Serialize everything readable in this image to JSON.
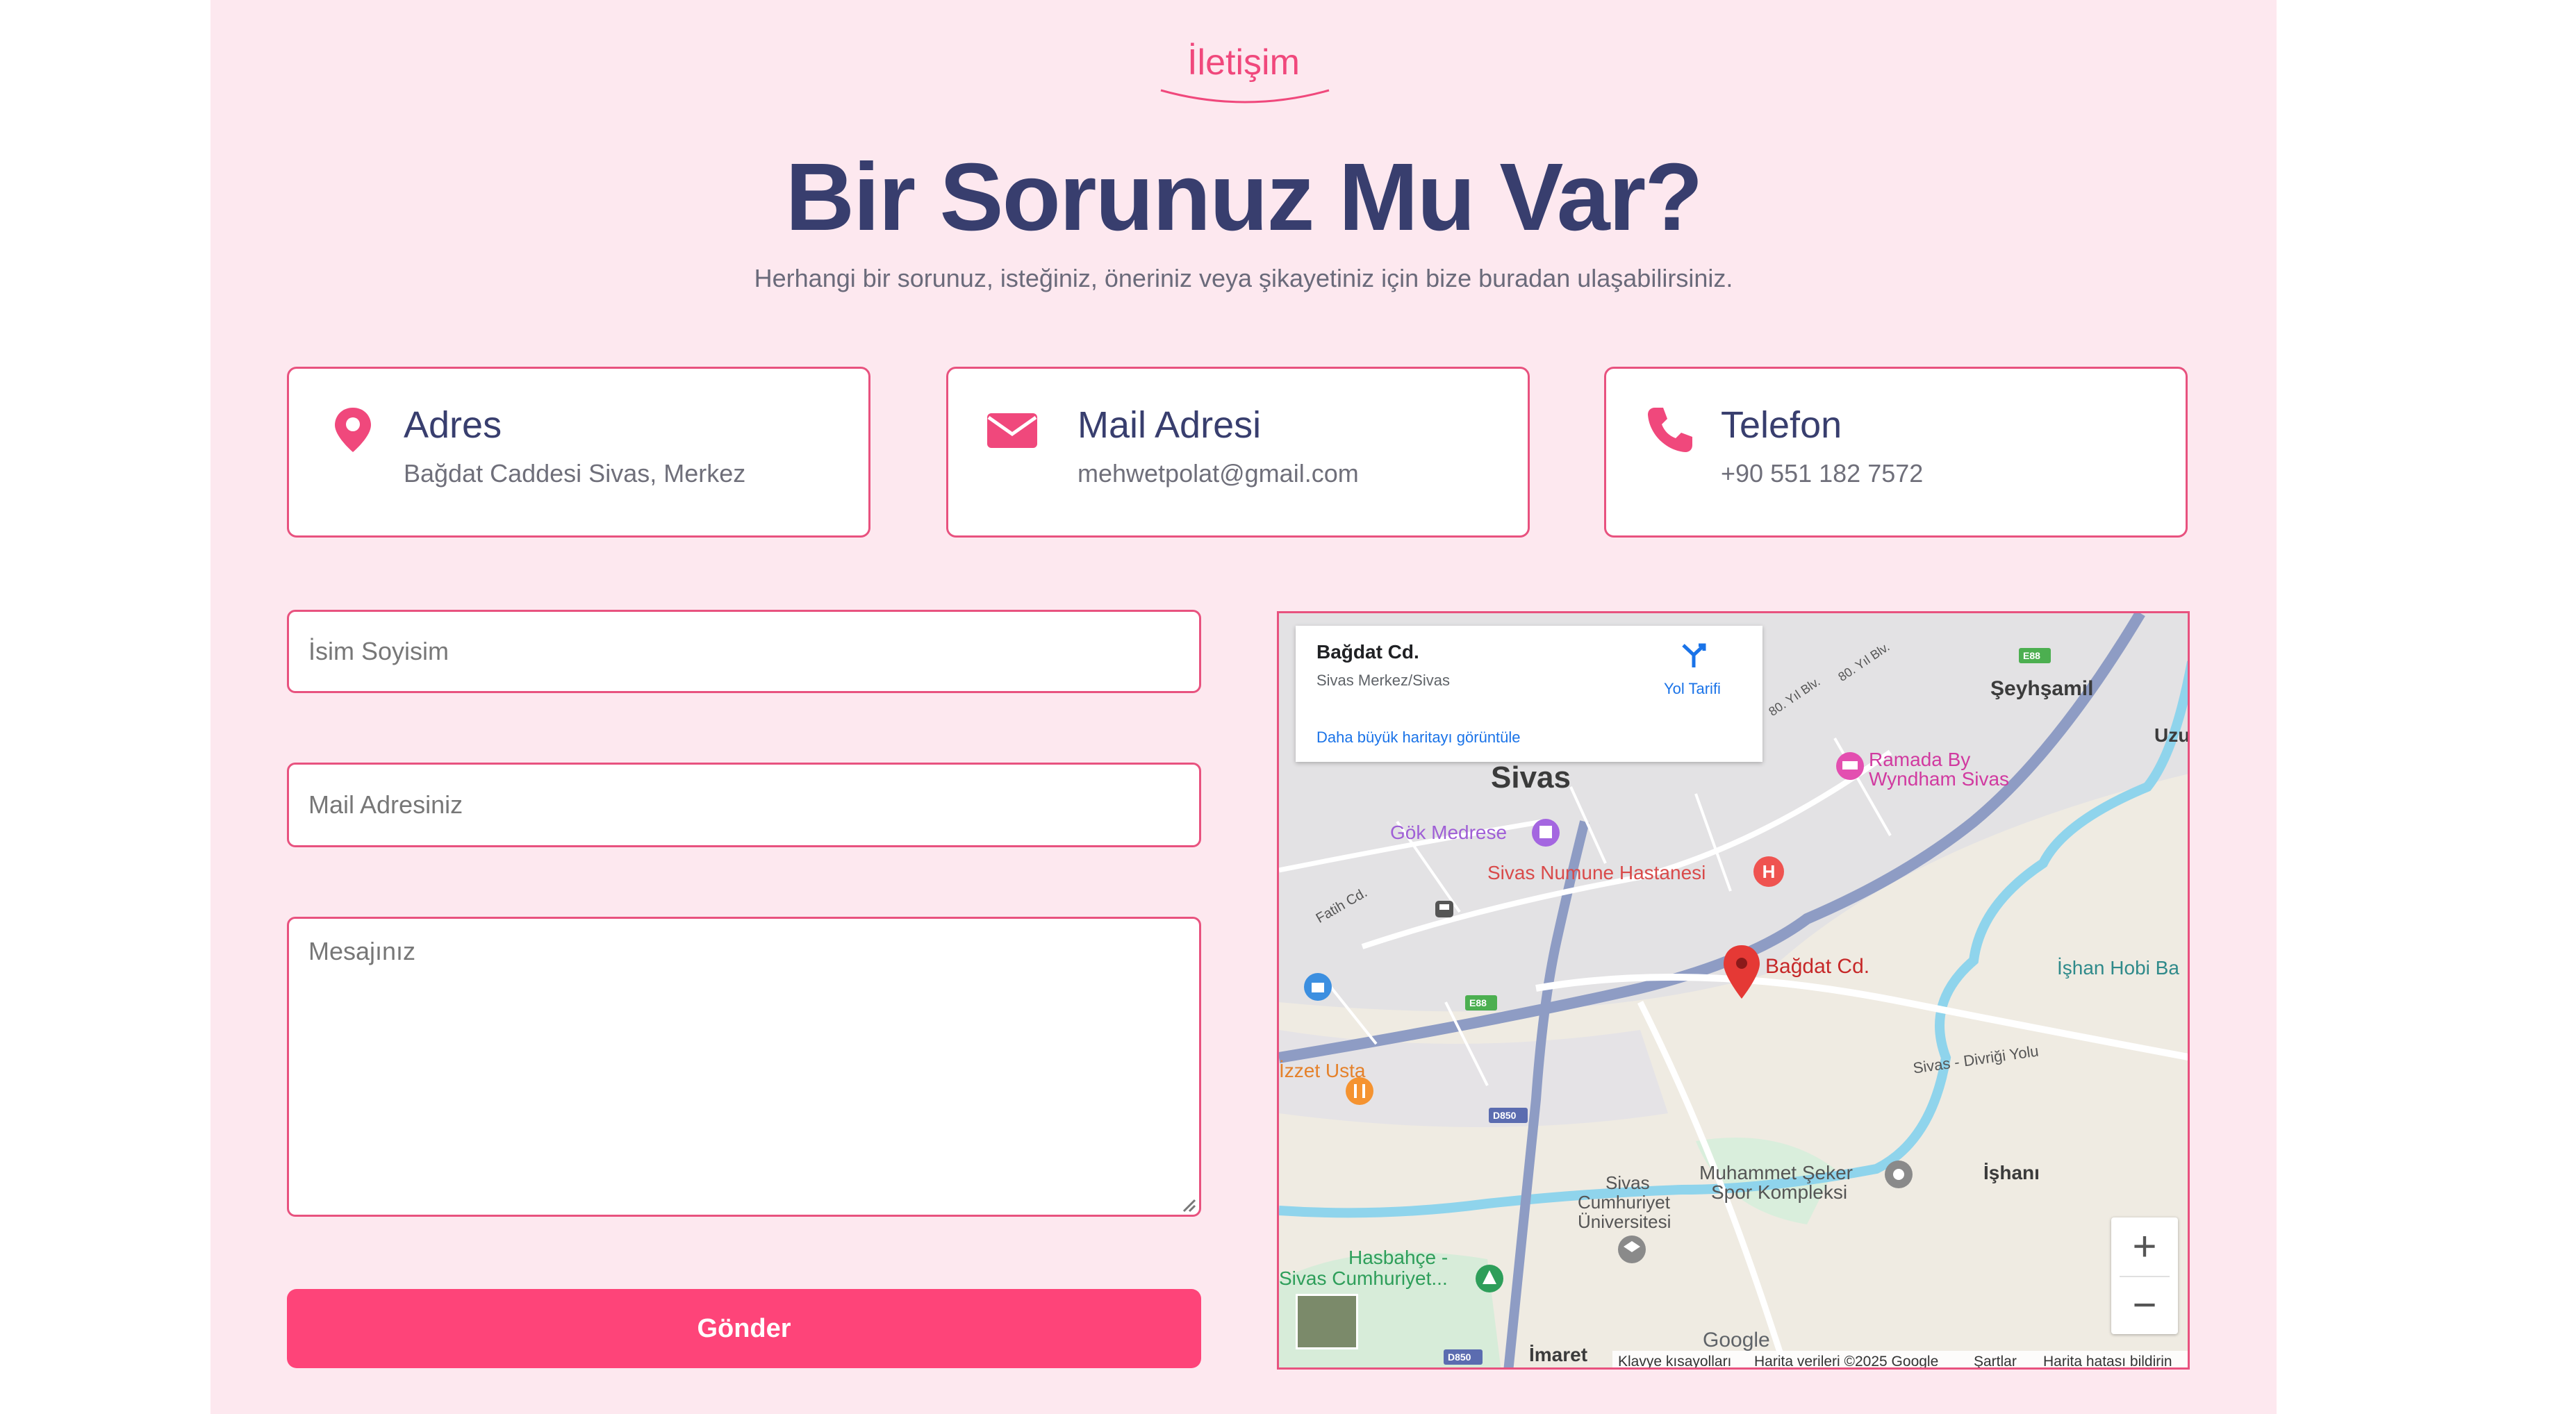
{
  "header": {
    "section_label": "İletişim",
    "title": "Bir Sorunuz Mu Var?",
    "subtitle": "Herhangi bir sorunuz, isteğiniz, öneriniz veya şikayetiniz için bize buradan ulaşabilirsiniz."
  },
  "cards": [
    {
      "title": "Adres",
      "value": "Bağdat Caddesi Sivas, Merkez",
      "icon": "map-marker-icon"
    },
    {
      "title": "Mail Adresi",
      "value": "mehwetpolat@gmail.com",
      "icon": "envelope-icon"
    },
    {
      "title": "Telefon",
      "value": "+90 551 182 7572",
      "icon": "phone-icon"
    }
  ],
  "form": {
    "name_placeholder": "İsim Soyisim",
    "email_placeholder": "Mail Adresiniz",
    "message_placeholder": "Mesajınız",
    "submit_label": "Gönder"
  },
  "map": {
    "info": {
      "place_name": "Bağdat Cd.",
      "place_address": "Sivas Merkez/Sivas",
      "directions_label": "Yol Tarifi",
      "larger_map_link": "Daha büyük haritayı görüntüle"
    },
    "labels": {
      "city": "Sivas",
      "seyhsamil": "Şeyhşamil",
      "ramada_1": "Ramada By",
      "ramada_2": "Wyndham Sivas",
      "gok_medrese": "Gök Medrese",
      "hospital": "Sivas Numune Hastanesi",
      "pin_label": "Bağdat Cd.",
      "ishan_hobi": "İşhan Hobi Ba",
      "izzet_usta": "İzzet Usta",
      "divrigi_yolu": "Sivas - Divriği Yolu",
      "muhammet_1": "Muhammet Şeker",
      "muhammet_2": "Spor Kompleksi",
      "univ_1": "Sivas",
      "univ_2": "Cumhuriyet",
      "univ_3": "Üniversitesi",
      "ishani": "İşhanı",
      "hasbahce_1": "Hasbahçe -",
      "hasbahce_2": "Sivas Cumhuriyet...",
      "imaret": "İmaret",
      "uzu": "Uzu",
      "fatih_cd": "Fatih Cd.",
      "e88_a": "E88",
      "e88_b": "E88",
      "d850_a": "D850",
      "d850_b": "D850",
      "road_80_1": "80. Yıl Blv.",
      "road_80_2": "80. Yıl Blv."
    },
    "google_logo": "Google",
    "footer": {
      "shortcuts": "Klavye kısayolları",
      "map_data": "Harita verileri ©2025 Google",
      "terms": "Şartlar",
      "report": "Harita hatası bildirin"
    },
    "zoom_in": "+",
    "zoom_out": "−"
  },
  "colors": {
    "background": "#fde8ef",
    "accent": "#fe4479",
    "border": "#e8527f",
    "heading": "#383e6e",
    "icon": "#f0487c"
  }
}
